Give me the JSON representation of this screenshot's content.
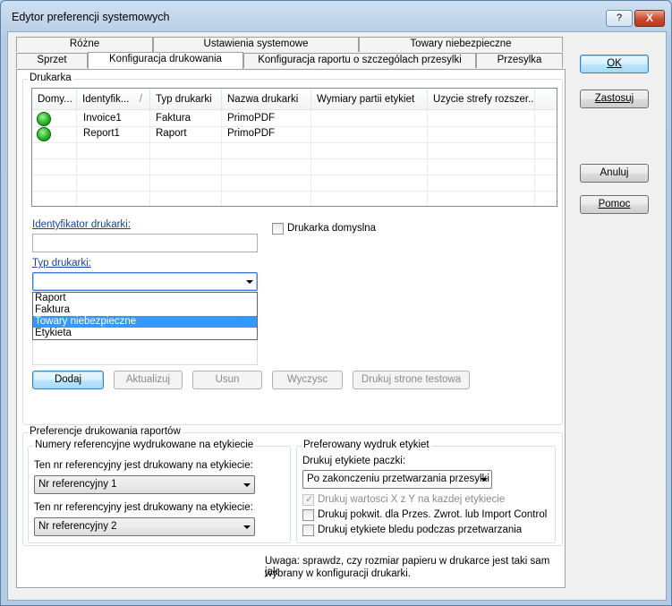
{
  "window": {
    "title": "Edytor preferencji systemowych",
    "help_label": "?",
    "close_label": "X"
  },
  "tabs_row1": [
    {
      "label": "Różne"
    },
    {
      "label": "Ustawienia systemowe"
    },
    {
      "label": "Towary niebezpieczne"
    }
  ],
  "tabs_row2": [
    {
      "label": "Sprzet"
    },
    {
      "label": "Konfiguracja drukowania"
    },
    {
      "label": "Konfiguracja raportu o szczególach przesylki"
    },
    {
      "label": "Przesylka"
    }
  ],
  "printer_group": {
    "title": "Drukarka",
    "columns": [
      "Domy...",
      "Identyfik...",
      "Typ drukarki",
      "Nazwa drukarki",
      "Wymiary partii etykiet",
      "Uzycie strefy rozszer..."
    ],
    "sort_indicator": "/",
    "rows": [
      {
        "id": "Invoice1",
        "type": "Faktura",
        "name": "PrimoPDF"
      },
      {
        "id": "Report1",
        "type": "Raport",
        "name": "PrimoPDF"
      }
    ],
    "id_label": "Identyfikator drukarki:",
    "id_value": "",
    "default_label": "Drukarka domyslna",
    "type_label": "Typ drukarki:",
    "type_value": "",
    "type_options": [
      "Raport",
      "Faktura",
      "Towary niebezpieczne",
      "Etykieta"
    ],
    "type_highlighted": "Towary niebezpieczne",
    "buttons": {
      "add": "Dodaj",
      "update": "Aktualizuj",
      "delete": "Usun",
      "clear": "Wyczysc",
      "test": "Drukuj strone testowa"
    }
  },
  "report_prefs": {
    "title": "Preferencje drukowania raportów",
    "refs_group": {
      "title": "Numery referencyjne wydrukowane na etykiecie",
      "label1": "Ten nr referencyjny jest drukowany na etykiecie:",
      "value1": "Nr referencyjny 1",
      "label2": "Ten nr referencyjny jest drukowany na etykiecie:",
      "value2": "Nr referencyjny 2"
    },
    "label_print_group": {
      "title": "Preferowany wydruk etykiet",
      "package_label": "Drukuj etykiete paczki:",
      "package_value": "Po zakonczeniu przetwarzania przesylki",
      "chk_xy": "Drukuj wartosci X z Y na kazdej etykiecie",
      "chk_receipt": "Drukuj pokwit. dla Przes. Zwrot. lub Import Control",
      "chk_error": "Drukuj etykiete bledu podczas przetwarzania"
    }
  },
  "note": {
    "line1": "Uwaga: sprawdz, czy rozmiar papieru w drukarce jest taki sam jak",
    "line2": "wybrany w konfiguracji drukarki."
  },
  "side_buttons": {
    "ok": "OK",
    "apply": "Zastosuj",
    "cancel": "Anuluj",
    "help": "Pomoc"
  },
  "colors": {
    "selection": "#3399ff",
    "status_green": "#22b922",
    "label_blue": "#1a3fa0"
  }
}
